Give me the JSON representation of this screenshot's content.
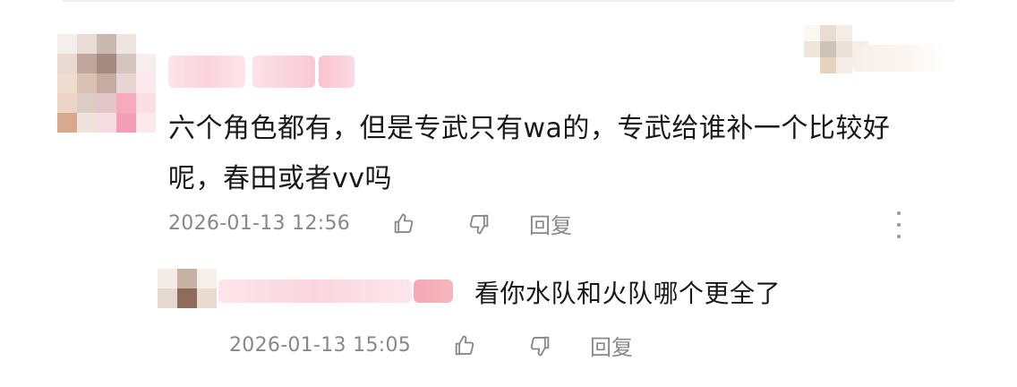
{
  "comment": {
    "text": "六个角色都有，但是专武只有wa的，专武给谁补一个比较好呢，春田或者vv吗",
    "timestamp": "2026-01-13 12:56",
    "reply_label": "回复",
    "icons": {
      "like": "thumbs-up-icon",
      "dislike": "thumbs-down-icon",
      "more": "more-vertical-icon"
    }
  },
  "reply": {
    "text": "看你水队和火队哪个更全了",
    "timestamp": "2026-01-13 15:05",
    "reply_label": "回复",
    "icons": {
      "like": "thumbs-up-icon",
      "dislike": "thumbs-down-icon"
    }
  },
  "colors": {
    "text": "#191919",
    "meta": "#888888",
    "blur_pink": "#fbd3dc"
  }
}
